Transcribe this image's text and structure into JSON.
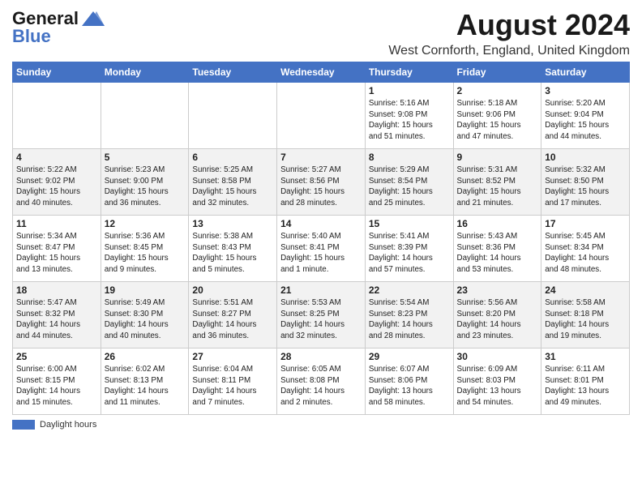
{
  "header": {
    "logo_line1": "General",
    "logo_line2": "Blue",
    "month_year": "August 2024",
    "location": "West Cornforth, England, United Kingdom"
  },
  "calendar": {
    "days_of_week": [
      "Sunday",
      "Monday",
      "Tuesday",
      "Wednesday",
      "Thursday",
      "Friday",
      "Saturday"
    ],
    "weeks": [
      [
        {
          "day": "",
          "info": ""
        },
        {
          "day": "",
          "info": ""
        },
        {
          "day": "",
          "info": ""
        },
        {
          "day": "",
          "info": ""
        },
        {
          "day": "1",
          "info": "Sunrise: 5:16 AM\nSunset: 9:08 PM\nDaylight: 15 hours\nand 51 minutes."
        },
        {
          "day": "2",
          "info": "Sunrise: 5:18 AM\nSunset: 9:06 PM\nDaylight: 15 hours\nand 47 minutes."
        },
        {
          "day": "3",
          "info": "Sunrise: 5:20 AM\nSunset: 9:04 PM\nDaylight: 15 hours\nand 44 minutes."
        }
      ],
      [
        {
          "day": "4",
          "info": "Sunrise: 5:22 AM\nSunset: 9:02 PM\nDaylight: 15 hours\nand 40 minutes."
        },
        {
          "day": "5",
          "info": "Sunrise: 5:23 AM\nSunset: 9:00 PM\nDaylight: 15 hours\nand 36 minutes."
        },
        {
          "day": "6",
          "info": "Sunrise: 5:25 AM\nSunset: 8:58 PM\nDaylight: 15 hours\nand 32 minutes."
        },
        {
          "day": "7",
          "info": "Sunrise: 5:27 AM\nSunset: 8:56 PM\nDaylight: 15 hours\nand 28 minutes."
        },
        {
          "day": "8",
          "info": "Sunrise: 5:29 AM\nSunset: 8:54 PM\nDaylight: 15 hours\nand 25 minutes."
        },
        {
          "day": "9",
          "info": "Sunrise: 5:31 AM\nSunset: 8:52 PM\nDaylight: 15 hours\nand 21 minutes."
        },
        {
          "day": "10",
          "info": "Sunrise: 5:32 AM\nSunset: 8:50 PM\nDaylight: 15 hours\nand 17 minutes."
        }
      ],
      [
        {
          "day": "11",
          "info": "Sunrise: 5:34 AM\nSunset: 8:47 PM\nDaylight: 15 hours\nand 13 minutes."
        },
        {
          "day": "12",
          "info": "Sunrise: 5:36 AM\nSunset: 8:45 PM\nDaylight: 15 hours\nand 9 minutes."
        },
        {
          "day": "13",
          "info": "Sunrise: 5:38 AM\nSunset: 8:43 PM\nDaylight: 15 hours\nand 5 minutes."
        },
        {
          "day": "14",
          "info": "Sunrise: 5:40 AM\nSunset: 8:41 PM\nDaylight: 15 hours\nand 1 minute."
        },
        {
          "day": "15",
          "info": "Sunrise: 5:41 AM\nSunset: 8:39 PM\nDaylight: 14 hours\nand 57 minutes."
        },
        {
          "day": "16",
          "info": "Sunrise: 5:43 AM\nSunset: 8:36 PM\nDaylight: 14 hours\nand 53 minutes."
        },
        {
          "day": "17",
          "info": "Sunrise: 5:45 AM\nSunset: 8:34 PM\nDaylight: 14 hours\nand 48 minutes."
        }
      ],
      [
        {
          "day": "18",
          "info": "Sunrise: 5:47 AM\nSunset: 8:32 PM\nDaylight: 14 hours\nand 44 minutes."
        },
        {
          "day": "19",
          "info": "Sunrise: 5:49 AM\nSunset: 8:30 PM\nDaylight: 14 hours\nand 40 minutes."
        },
        {
          "day": "20",
          "info": "Sunrise: 5:51 AM\nSunset: 8:27 PM\nDaylight: 14 hours\nand 36 minutes."
        },
        {
          "day": "21",
          "info": "Sunrise: 5:53 AM\nSunset: 8:25 PM\nDaylight: 14 hours\nand 32 minutes."
        },
        {
          "day": "22",
          "info": "Sunrise: 5:54 AM\nSunset: 8:23 PM\nDaylight: 14 hours\nand 28 minutes."
        },
        {
          "day": "23",
          "info": "Sunrise: 5:56 AM\nSunset: 8:20 PM\nDaylight: 14 hours\nand 23 minutes."
        },
        {
          "day": "24",
          "info": "Sunrise: 5:58 AM\nSunset: 8:18 PM\nDaylight: 14 hours\nand 19 minutes."
        }
      ],
      [
        {
          "day": "25",
          "info": "Sunrise: 6:00 AM\nSunset: 8:15 PM\nDaylight: 14 hours\nand 15 minutes."
        },
        {
          "day": "26",
          "info": "Sunrise: 6:02 AM\nSunset: 8:13 PM\nDaylight: 14 hours\nand 11 minutes."
        },
        {
          "day": "27",
          "info": "Sunrise: 6:04 AM\nSunset: 8:11 PM\nDaylight: 14 hours\nand 7 minutes."
        },
        {
          "day": "28",
          "info": "Sunrise: 6:05 AM\nSunset: 8:08 PM\nDaylight: 14 hours\nand 2 minutes."
        },
        {
          "day": "29",
          "info": "Sunrise: 6:07 AM\nSunset: 8:06 PM\nDaylight: 13 hours\nand 58 minutes."
        },
        {
          "day": "30",
          "info": "Sunrise: 6:09 AM\nSunset: 8:03 PM\nDaylight: 13 hours\nand 54 minutes."
        },
        {
          "day": "31",
          "info": "Sunrise: 6:11 AM\nSunset: 8:01 PM\nDaylight: 13 hours\nand 49 minutes."
        }
      ]
    ]
  },
  "footer": {
    "legend_label": "Daylight hours"
  }
}
